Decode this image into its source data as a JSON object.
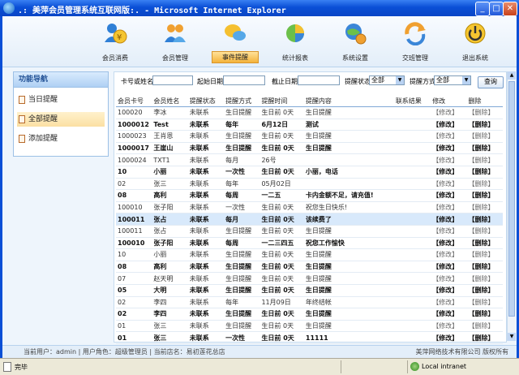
{
  "window": {
    "title": ".: 美萍会员管理系统互联网版:. - Microsoft Internet Explorer",
    "minimize": "_",
    "maximize": "□",
    "close": "✕"
  },
  "topnav": [
    {
      "label": "会员消费",
      "icon": "coin-user-icon",
      "color": "#e6b02a"
    },
    {
      "label": "会员管理",
      "icon": "users-icon",
      "color": "#2f7fd6"
    },
    {
      "label": "事件提醒",
      "icon": "chat-bubbles-icon",
      "color": "#f2a81c"
    },
    {
      "label": "统计报表",
      "icon": "pie-chart-icon",
      "color": "#57b33c"
    },
    {
      "label": "系统设置",
      "icon": "globe-gear-icon",
      "color": "#3a86d8"
    },
    {
      "label": "交班管理",
      "icon": "refresh-arrow-icon",
      "color": "#e8a11a"
    },
    {
      "label": "退出系统",
      "icon": "power-icon",
      "color": "#e0b000"
    }
  ],
  "sidebar": {
    "title": "功能导航",
    "items": [
      {
        "label": "当日提醒"
      },
      {
        "label": "全部提醒"
      },
      {
        "label": "添加提醒"
      }
    ]
  },
  "filter": {
    "card_label": "卡号或姓名",
    "start_label": "起始日期",
    "end_label": "截止日期",
    "status_label": "提醒状态",
    "status_value": "全部",
    "method_label": "提醒方式",
    "method_value": "全部",
    "query_button": "查询"
  },
  "table": {
    "headers": [
      "会员卡号",
      "会员姓名",
      "提醒状态",
      "提醒方式",
      "提醒时间",
      "提醒内容",
      "联系结果",
      "修改",
      "删除"
    ],
    "edit_label": "【修改】",
    "delete_label": "【删除】",
    "rows": [
      {
        "card": "100020",
        "name": "李冰",
        "status": "未联系",
        "method": "生日提醒",
        "time": "生日前 0天",
        "content": "生日提醒",
        "result": "",
        "bold": false
      },
      {
        "card": "1000012",
        "name": "Test",
        "status": "未联系",
        "method": "每年",
        "time": "6月12日",
        "content": "测试",
        "result": "",
        "bold": true
      },
      {
        "card": "1000023",
        "name": "王肖恩",
        "status": "未联系",
        "method": "生日提醒",
        "time": "生日前 0天",
        "content": "生日提醒",
        "result": "",
        "bold": false
      },
      {
        "card": "1000017",
        "name": "王崖山",
        "status": "未联系",
        "method": "生日提醒",
        "time": "生日前 0天",
        "content": "生日提醒",
        "result": "",
        "bold": true
      },
      {
        "card": "1000024",
        "name": "TXT1",
        "status": "未联系",
        "method": "每月",
        "time": "26号",
        "content": "",
        "result": "",
        "bold": false
      },
      {
        "card": "10",
        "name": "小丽",
        "status": "未联系",
        "method": "一次性",
        "time": "生日前 0天",
        "content": "小丽，电话",
        "result": "",
        "bold": true
      },
      {
        "card": "02",
        "name": "张三",
        "status": "未联系",
        "method": "每年",
        "time": "05月02日",
        "content": "",
        "result": "",
        "bold": false
      },
      {
        "card": "08",
        "name": "高利",
        "status": "未联系",
        "method": "每周",
        "time": "一二五",
        "content": "卡内金额不足，请充值!",
        "result": "",
        "bold": true
      },
      {
        "card": "100010",
        "name": "张子阳",
        "status": "未联系",
        "method": "一次性",
        "time": "生日前 0天",
        "content": "祝您生日快乐!",
        "result": "",
        "bold": false
      },
      {
        "card": "100011",
        "name": "张占",
        "status": "未联系",
        "method": "每月",
        "time": "生日前 0天",
        "content": "该续费了",
        "result": "",
        "bold": true,
        "highlight": true
      },
      {
        "card": "100011",
        "name": "张占",
        "status": "未联系",
        "method": "生日提醒",
        "time": "生日前 0天",
        "content": "生日提醒",
        "result": "",
        "bold": false
      },
      {
        "card": "100010",
        "name": "张子阳",
        "status": "未联系",
        "method": "每周",
        "time": "一二三四五",
        "content": "祝您工作愉快",
        "result": "",
        "bold": true
      },
      {
        "card": "10",
        "name": "小丽",
        "status": "未联系",
        "method": "生日提醒",
        "time": "生日前 0天",
        "content": "生日提醒",
        "result": "",
        "bold": false
      },
      {
        "card": "08",
        "name": "高利",
        "status": "未联系",
        "method": "生日提醒",
        "time": "生日前 0天",
        "content": "生日提醒",
        "result": "",
        "bold": true
      },
      {
        "card": "07",
        "name": "赵天明",
        "status": "未联系",
        "method": "生日提醒",
        "time": "生日前 0天",
        "content": "生日提醒",
        "result": "",
        "bold": false
      },
      {
        "card": "05",
        "name": "大明",
        "status": "未联系",
        "method": "生日提醒",
        "time": "生日前 0天",
        "content": "生日提醒",
        "result": "",
        "bold": true
      },
      {
        "card": "02",
        "name": "李四",
        "status": "未联系",
        "method": "每年",
        "time": "11月09日",
        "content": "年终结帐",
        "result": "",
        "bold": false
      },
      {
        "card": "02",
        "name": "李四",
        "status": "未联系",
        "method": "生日提醒",
        "time": "生日前 0天",
        "content": "生日提醒",
        "result": "",
        "bold": true
      },
      {
        "card": "01",
        "name": "张三",
        "status": "未联系",
        "method": "生日提醒",
        "time": "生日前 0天",
        "content": "生日提醒",
        "result": "",
        "bold": false
      },
      {
        "card": "01",
        "name": "张三",
        "status": "未联系",
        "method": "一次性",
        "time": "生日前 0天",
        "content": "11111",
        "result": "",
        "bold": true
      }
    ]
  },
  "footer": {
    "left": "当前用户：admin  |  用户角色：超级管理员  |  当前店名：易初莲花总店",
    "right": "美萍网络技术有限公司  版权所有"
  },
  "statusbar": {
    "done": "完毕",
    "zone": "Local intranet"
  }
}
